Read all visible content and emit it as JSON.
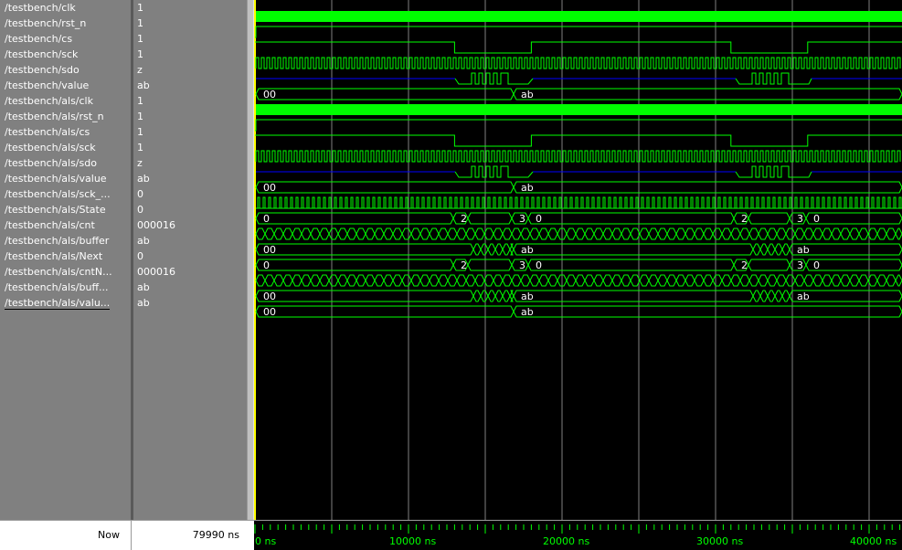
{
  "signals": [
    {
      "name": "/testbench/clk",
      "value": "1"
    },
    {
      "name": "/testbench/rst_n",
      "value": "1"
    },
    {
      "name": "/testbench/cs",
      "value": "1"
    },
    {
      "name": "/testbench/sck",
      "value": "1"
    },
    {
      "name": "/testbench/sdo",
      "value": "z"
    },
    {
      "name": "/testbench/value",
      "value": "ab"
    },
    {
      "name": "/testbench/als/clk",
      "value": "1"
    },
    {
      "name": "/testbench/als/rst_n",
      "value": "1"
    },
    {
      "name": "/testbench/als/cs",
      "value": "1"
    },
    {
      "name": "/testbench/als/sck",
      "value": "1"
    },
    {
      "name": "/testbench/als/sdo",
      "value": "z"
    },
    {
      "name": "/testbench/als/value",
      "value": "ab"
    },
    {
      "name": "/testbench/als/sck_...",
      "value": "0"
    },
    {
      "name": "/testbench/als/State",
      "value": "0"
    },
    {
      "name": "/testbench/als/cnt",
      "value": "000016"
    },
    {
      "name": "/testbench/als/buffer",
      "value": "ab"
    },
    {
      "name": "/testbench/als/Next",
      "value": "0"
    },
    {
      "name": "/testbench/als/cntN...",
      "value": "000016"
    },
    {
      "name": "/testbench/als/buff...",
      "value": "ab"
    },
    {
      "name": "/testbench/als/valu...",
      "value": "ab"
    }
  ],
  "status": {
    "now_label": "Now",
    "now_value": "79990 ns"
  },
  "time_axis": {
    "labels": [
      "0 ns",
      "10000 ns",
      "20000 ns",
      "30000 ns",
      "40000 ns"
    ]
  },
  "waves": {
    "bus_labels": {
      "value_initial": "00",
      "value_final": "ab",
      "state_initial": "0",
      "state_seq": [
        "2",
        "3",
        "0"
      ],
      "buffer_initial": "00",
      "buffer_final": "ab"
    }
  },
  "colors": {
    "wave": "#00ff00",
    "sdo_z": "#0000ff",
    "grid": "#808080",
    "label": "#ffffff"
  }
}
